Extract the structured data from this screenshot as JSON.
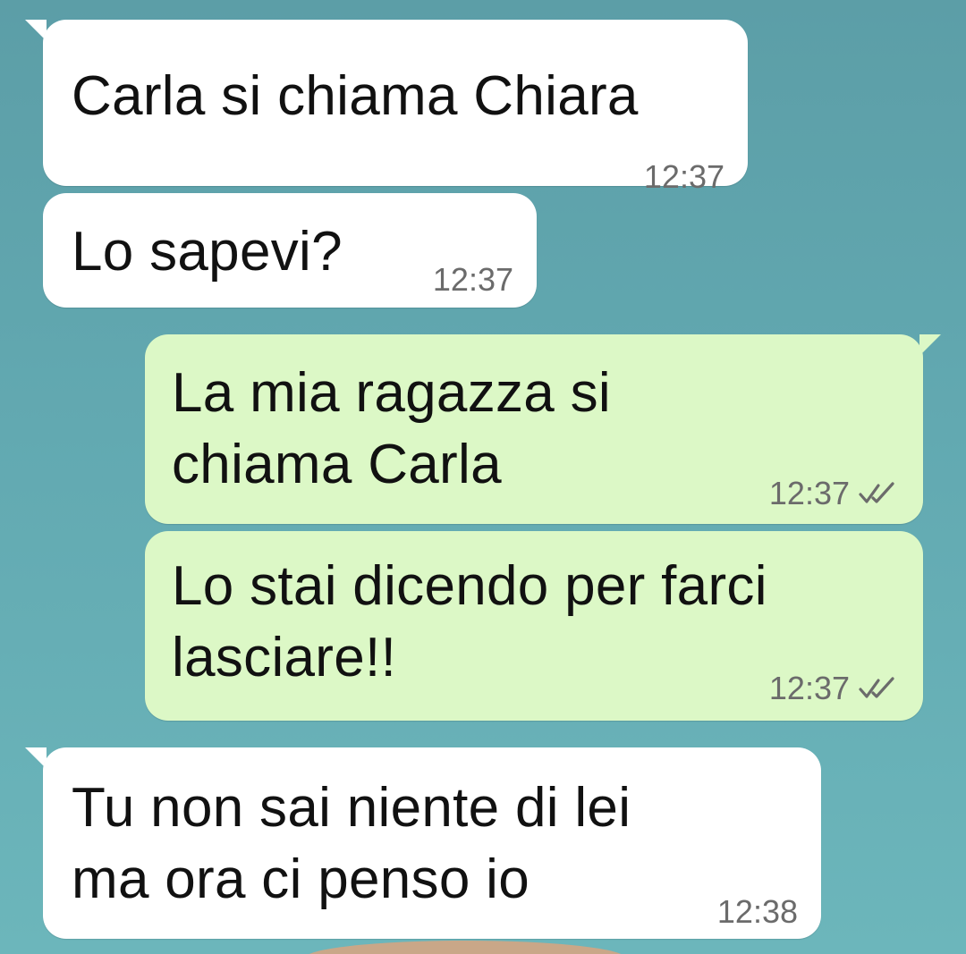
{
  "conversation": {
    "messages": [
      {
        "direction": "incoming",
        "text": "Carla si chiama Chiara",
        "time": "12:37"
      },
      {
        "direction": "incoming",
        "text": "Lo sapevi?",
        "time": "12:37"
      },
      {
        "direction": "outgoing",
        "text": "La mia ragazza si\nchiama Carla",
        "time": "12:37",
        "status": "read"
      },
      {
        "direction": "outgoing",
        "text": "Lo stai dicendo per farci\nlasciare!!",
        "time": "12:37",
        "status": "read"
      },
      {
        "direction": "incoming",
        "text": "Tu non sai niente di lei\nma ora ci penso io",
        "time": "12:38"
      }
    ]
  },
  "colors": {
    "incoming_bubble": "#ffffff",
    "outgoing_bubble": "#dcf8c6",
    "background": "#62a9b1",
    "timestamp": "#6b6b6b",
    "read_ticks": "#6b6b6b"
  },
  "icons": {
    "read_receipt": "double-check-icon"
  }
}
